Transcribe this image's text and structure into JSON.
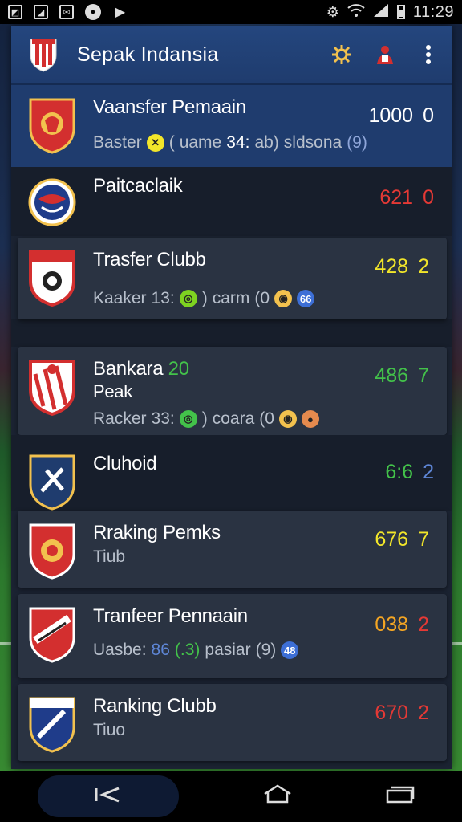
{
  "status_bar": {
    "time": "11:29",
    "left_icons": [
      "image-icon",
      "chart-icon",
      "mail-icon",
      "record-icon",
      "play-icon"
    ],
    "right_icons": [
      "alarm-icon",
      "wifi-icon",
      "signal-icon",
      "battery-icon"
    ]
  },
  "app_bar": {
    "title": "Sepak Indansia",
    "actions": [
      "settings-icon",
      "player-icon",
      "more-vert-icon"
    ]
  },
  "rows": [
    {
      "name": "Vaansfer Pemaain",
      "sub": [
        "Baster",
        "(",
        "uame",
        "34:",
        "ab)",
        "sldsona",
        "(9)"
      ],
      "score_a": "1000",
      "score_b": "0",
      "color_a": "#ffffff",
      "color_b": "#ffffff",
      "style": "hl"
    },
    {
      "name": "Paitcaclaik",
      "sub": [],
      "score_a": "621",
      "score_b": "0",
      "color_a": "#e53935",
      "color_b": "#e53935",
      "style": "dark"
    },
    {
      "name": "Trasfer Clubb",
      "sub": [
        "Kaaker",
        "13:",
        ")",
        "carm",
        "(0"
      ],
      "score_a": "428",
      "score_b": "2",
      "color_a": "#f2e62a",
      "color_b": "#f2e62a",
      "style": "card"
    },
    {
      "name": "Bankara",
      "name_badge": "20",
      "name_line2": "Peak",
      "sub": [
        "Racker",
        "33:",
        ")",
        "coara",
        "(0"
      ],
      "score_a": "486",
      "score_b": "7",
      "color_a": "#43c24a",
      "color_b": "#43c24a",
      "style": "card"
    },
    {
      "name": "Cluhoid",
      "sub": [],
      "score_a": "6:6",
      "score_b": "2",
      "color_a": "#43c24a",
      "color_b": "#5e86d6",
      "style": "dark"
    },
    {
      "name": "Rraking Pemks",
      "sub_plain": "Tiub",
      "score_a": "676",
      "score_b": "7",
      "color_a": "#f2e62a",
      "color_b": "#f2e62a",
      "style": "card"
    },
    {
      "name": "Tranfeer Pennaain",
      "sub": [
        "Uasbe:",
        "86",
        "(.3)",
        "pasiar",
        "(9)"
      ],
      "score_a": "038",
      "score_b": "2",
      "color_a": "#f5a623",
      "color_b": "#e53935",
      "style": "card"
    },
    {
      "name": "Ranking Clubb",
      "sub_plain": "Tiuo",
      "score_a": "670",
      "score_b": "2",
      "color_a": "#e53935",
      "color_b": "#e53935",
      "style": "card"
    }
  ],
  "nav_bar": {
    "items": [
      "back-icon",
      "home-icon",
      "recents-icon"
    ]
  }
}
